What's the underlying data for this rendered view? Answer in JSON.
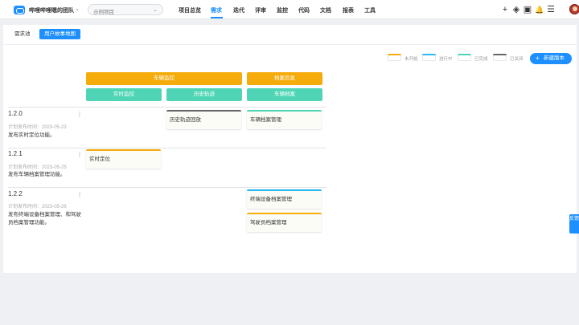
{
  "topbar": {
    "team_name": "哔哩哔哩嗯的团队",
    "team_caret": "⌄",
    "project_select": {
      "value": "示例项目",
      "caret": "⌄"
    },
    "nav": [
      {
        "label": "项目总览"
      },
      {
        "label": "需求"
      },
      {
        "label": "迭代"
      },
      {
        "label": "评审"
      },
      {
        "label": "监控"
      },
      {
        "label": "代码"
      },
      {
        "label": "文档"
      },
      {
        "label": "报表"
      },
      {
        "label": "工具"
      }
    ],
    "active_nav": "需求",
    "icons": {
      "add": "+",
      "layers": "◈",
      "briefcase": "▣",
      "bell": "🔔",
      "settings": "☰"
    }
  },
  "subtabs": [
    {
      "label": "需求池"
    },
    {
      "label": "用户故事地图"
    }
  ],
  "legend": [
    {
      "label": "未开始",
      "color": "#f5ab0a"
    },
    {
      "label": "进行中",
      "color": "#2cb8f2"
    },
    {
      "label": "已完成",
      "color": "#4fd5b5"
    },
    {
      "label": "已关闭",
      "color": "#666666"
    }
  ],
  "new_version_button": {
    "label": "新建版本",
    "icon": "+"
  },
  "epics": [
    {
      "label": "车辆监控"
    },
    {
      "label": "档案信息"
    }
  ],
  "features": [
    {
      "label": "实时监控"
    },
    {
      "label": "历史轨迹"
    },
    {
      "label": "车辆档案"
    }
  ],
  "versions": [
    {
      "name": "1.2.0",
      "more": "⋮",
      "date": "计划发布时间：2023-05-23",
      "desc": "发布实时定位功能。"
    },
    {
      "name": "1.2.1",
      "more": "⋮",
      "date": "计划发布时间：2023-05-25",
      "desc": "发布车辆档案管理功能。"
    },
    {
      "name": "1.2.2",
      "more": "⋮",
      "date": "计划发布时间：2023-05-26",
      "desc": "发布终端设备档案管理、和驾驶员档案管理功能。"
    }
  ],
  "stories": [
    {
      "title": "历史轨迹回放",
      "status_color": "#666666"
    },
    {
      "title": "车辆档案管理",
      "status_color": "#4fd5b5"
    },
    {
      "title": "实时定位",
      "status_color": "#f5ab0a"
    },
    {
      "title": "终端设备档案管理",
      "status_color": "#2cb8f2"
    },
    {
      "title": "驾驶员档案管理",
      "status_color": "#f5ab0a"
    }
  ],
  "feedback_label": "反馈"
}
